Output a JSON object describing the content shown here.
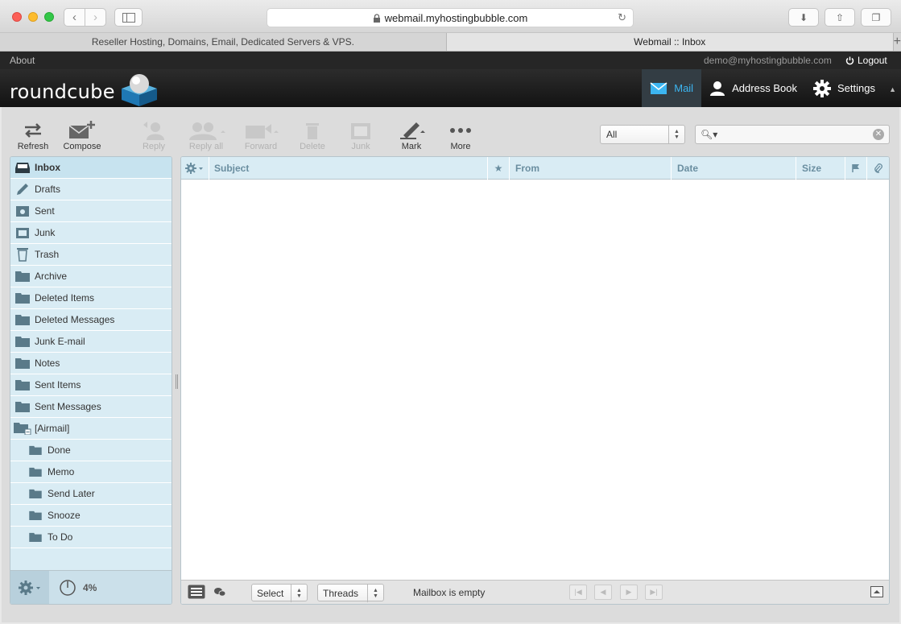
{
  "browser": {
    "url": "webmail.myhostingbubble.com",
    "tabs": [
      {
        "label": "Reseller Hosting, Domains, Email, Dedicated Servers & VPS."
      },
      {
        "label": "Webmail :: Inbox"
      }
    ]
  },
  "topline": {
    "about": "About",
    "user": "demo@myhostingbubble.com",
    "logout": "Logout"
  },
  "header": {
    "logo": "roundcube",
    "tasks": [
      {
        "label": "Mail",
        "icon": "envelope-icon",
        "active": true
      },
      {
        "label": "Address Book",
        "icon": "person-icon"
      },
      {
        "label": "Settings",
        "icon": "gear-icon"
      }
    ]
  },
  "toolbar": {
    "refresh": "Refresh",
    "compose": "Compose",
    "reply": "Reply",
    "reply_all": "Reply all",
    "forward": "Forward",
    "delete": "Delete",
    "junk": "Junk",
    "mark": "Mark",
    "more": "More"
  },
  "filter": {
    "selected": "All"
  },
  "search": {
    "value": ""
  },
  "folders": [
    {
      "label": "Inbox"
    },
    {
      "label": "Drafts"
    },
    {
      "label": "Sent"
    },
    {
      "label": "Junk"
    },
    {
      "label": "Trash"
    },
    {
      "label": "Archive"
    },
    {
      "label": "Deleted Items"
    },
    {
      "label": "Deleted Messages"
    },
    {
      "label": "Junk E-mail"
    },
    {
      "label": "Notes"
    },
    {
      "label": "Sent Items"
    },
    {
      "label": "Sent Messages"
    },
    {
      "label": "[Airmail]"
    },
    {
      "label": "Done"
    },
    {
      "label": "Memo"
    },
    {
      "label": "Send Later"
    },
    {
      "label": "Snooze"
    },
    {
      "label": "To Do"
    }
  ],
  "quota": {
    "value": "4%"
  },
  "list": {
    "columns": {
      "subject": "Subject",
      "from": "From",
      "date": "Date",
      "size": "Size"
    },
    "select_label": "Select",
    "threads_label": "Threads",
    "status": "Mailbox is empty"
  },
  "colors": {
    "accent": "#3cb5f1",
    "pane": "#d9ecf4"
  }
}
